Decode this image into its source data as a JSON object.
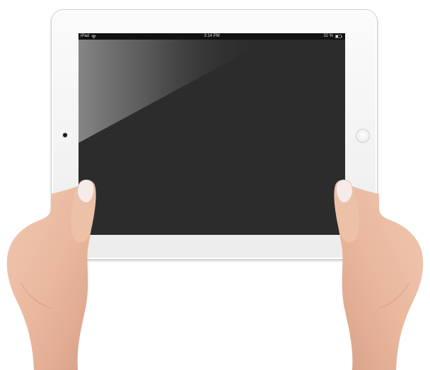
{
  "screen": {
    "status_bar": {
      "device_label": "iPad",
      "time": "3:14 PM",
      "battery_percent": "32 %",
      "wifi_icon": "wifi-icon",
      "battery_icon": "battery-icon"
    },
    "display_state": "blank-dark"
  },
  "colors": {
    "frame": "#f3f3f3",
    "screen": "#2c2c2c",
    "status_bar": "#111111",
    "skin": "#e9b9a0",
    "nail": "#f4e7e4"
  }
}
